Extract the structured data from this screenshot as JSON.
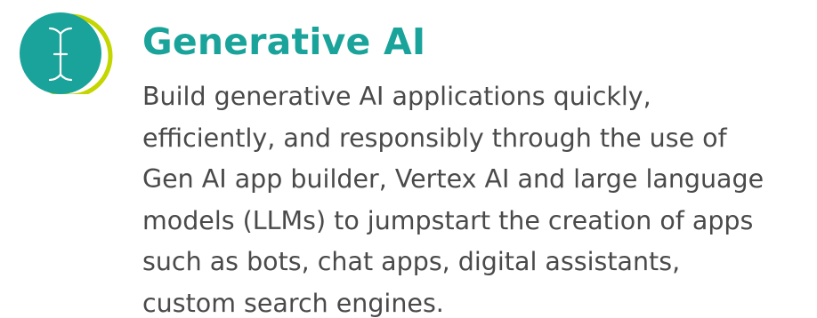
{
  "colors": {
    "accent_teal": "#1aa39a",
    "accent_lime": "#c4d600",
    "body_text": "#4a4a4a",
    "background": "#ffffff"
  },
  "icon": {
    "name": "text-cursor-icon"
  },
  "section": {
    "title": "Generative AI",
    "description_lines": [
      "Build generative AI applications quickly,",
      "efficiently, and responsibly through the use of",
      "Gen AI app builder, Vertex AI and large language",
      "models (LLMs) to jumpstart the creation of apps",
      "such as bots, chat apps, digital assistants,",
      "custom search engines."
    ]
  }
}
